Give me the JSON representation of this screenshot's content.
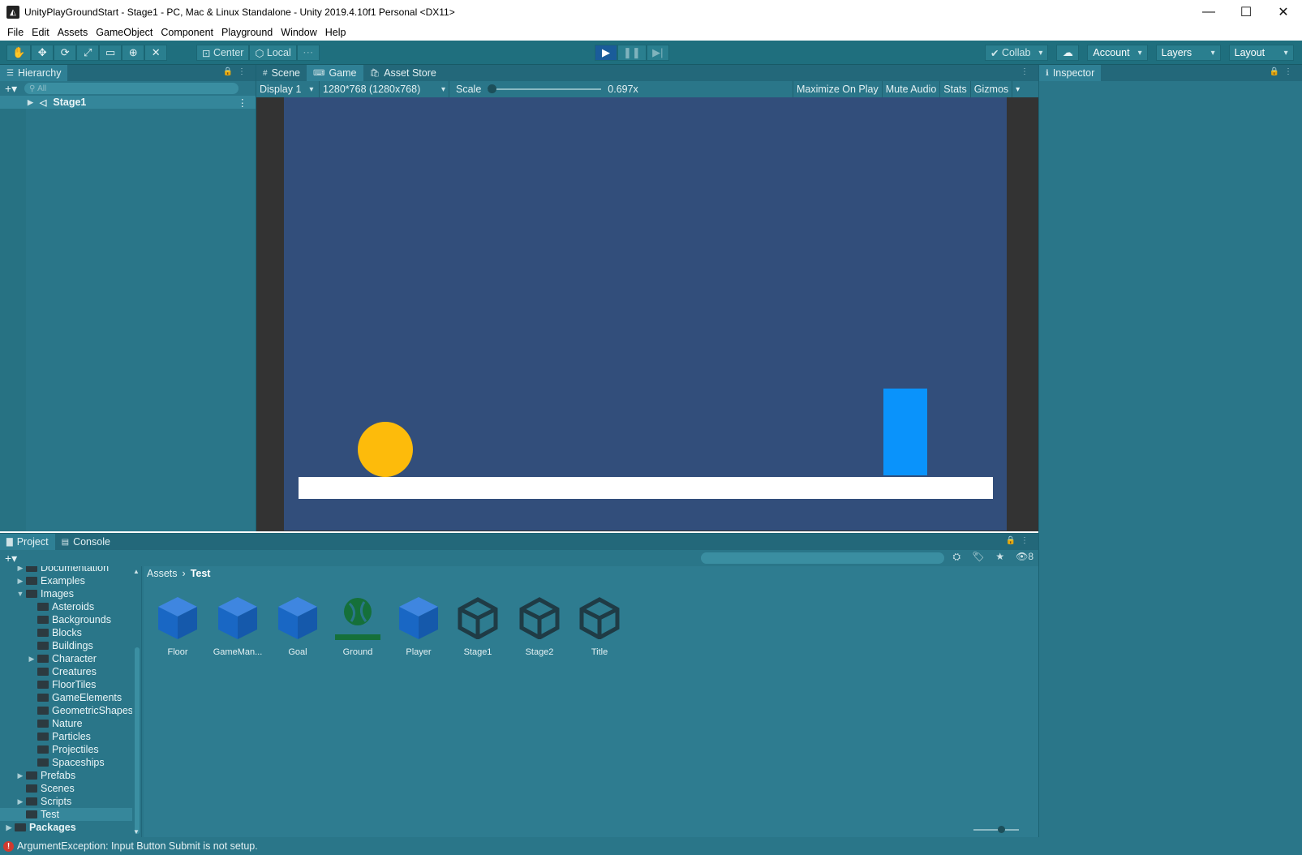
{
  "window": {
    "title": "UnityPlayGroundStart - Stage1 - PC, Mac & Linux Standalone - Unity 2019.4.10f1 Personal <DX11>",
    "controls": {
      "minimize": "—",
      "maximize": "☐",
      "close": "✕"
    }
  },
  "menu": [
    "File",
    "Edit",
    "Assets",
    "GameObject",
    "Component",
    "Playground",
    "Window",
    "Help"
  ],
  "toolbar": {
    "pivot_label": "Center",
    "space_label": "Local",
    "collab_label": "Collab",
    "account_label": "Account",
    "layers_label": "Layers",
    "layout_label": "Layout"
  },
  "hierarchy": {
    "tab": "Hierarchy",
    "search_placeholder": "All",
    "items": [
      {
        "label": "Stage1"
      }
    ]
  },
  "scene_tabs": {
    "scene": "Scene",
    "game": "Game",
    "asset_store": "Asset Store"
  },
  "game_toolbar": {
    "display": "Display 1",
    "resolution": "1280*768 (1280x768)",
    "scale_label": "Scale",
    "scale_value": "0.697x",
    "maximize": "Maximize On Play",
    "mute": "Mute Audio",
    "stats": "Stats",
    "gizmos": "Gizmos"
  },
  "inspector": {
    "tab": "Inspector"
  },
  "project": {
    "tab": "Project",
    "console_tab": "Console",
    "hidden_count": "8",
    "breadcrumb": [
      "Assets",
      "Test"
    ],
    "tree": [
      {
        "label": "Documentation",
        "indent": 1,
        "arrow": "▶"
      },
      {
        "label": "Examples",
        "indent": 1,
        "arrow": "▶"
      },
      {
        "label": "Images",
        "indent": 1,
        "arrow": "▼"
      },
      {
        "label": "Asteroids",
        "indent": 2,
        "arrow": ""
      },
      {
        "label": "Backgrounds",
        "indent": 2,
        "arrow": ""
      },
      {
        "label": "Blocks",
        "indent": 2,
        "arrow": ""
      },
      {
        "label": "Buildings",
        "indent": 2,
        "arrow": ""
      },
      {
        "label": "Character",
        "indent": 2,
        "arrow": "▶"
      },
      {
        "label": "Creatures",
        "indent": 2,
        "arrow": ""
      },
      {
        "label": "FloorTiles",
        "indent": 2,
        "arrow": ""
      },
      {
        "label": "GameElements",
        "indent": 2,
        "arrow": ""
      },
      {
        "label": "GeometricShapes",
        "indent": 2,
        "arrow": ""
      },
      {
        "label": "Nature",
        "indent": 2,
        "arrow": ""
      },
      {
        "label": "Particles",
        "indent": 2,
        "arrow": ""
      },
      {
        "label": "Projectiles",
        "indent": 2,
        "arrow": ""
      },
      {
        "label": "Spaceships",
        "indent": 2,
        "arrow": ""
      },
      {
        "label": "Prefabs",
        "indent": 1,
        "arrow": "▶"
      },
      {
        "label": "Scenes",
        "indent": 1,
        "arrow": ""
      },
      {
        "label": "Scripts",
        "indent": 1,
        "arrow": "▶"
      },
      {
        "label": "Test",
        "indent": 1,
        "arrow": "",
        "selected": true
      },
      {
        "label": "Packages",
        "indent": 0,
        "arrow": "▶",
        "bold": true
      }
    ],
    "assets": [
      {
        "label": "Floor",
        "icon": "prefab-cube-icon"
      },
      {
        "label": "GameMan...",
        "icon": "prefab-cube-icon"
      },
      {
        "label": "Goal",
        "icon": "prefab-cube-icon"
      },
      {
        "label": "Ground",
        "icon": "tilemap-icon"
      },
      {
        "label": "Player",
        "icon": "prefab-cube-icon"
      },
      {
        "label": "Stage1",
        "icon": "unity-scene-icon"
      },
      {
        "label": "Stage2",
        "icon": "unity-scene-icon"
      },
      {
        "label": "Title",
        "icon": "unity-scene-icon"
      }
    ]
  },
  "status": {
    "message": "ArgumentException: Input Button Submit is not setup."
  },
  "colors": {
    "panel": "#2a7689",
    "game_background": "#324e7b",
    "ball": "#fdbb0b",
    "goal": "#0a93fb",
    "ground": "#ffffff",
    "prefab_blue": "#1967c4",
    "tilemap_green": "#15703a"
  }
}
